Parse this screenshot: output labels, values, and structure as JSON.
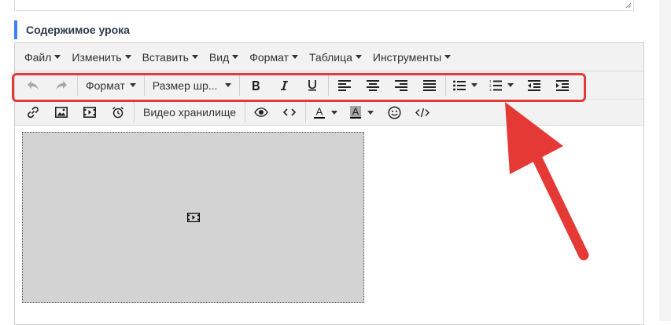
{
  "section": {
    "title": "Содержимое урока"
  },
  "menubar": {
    "items": [
      {
        "label": "Файл"
      },
      {
        "label": "Изменить"
      },
      {
        "label": "Вставить"
      },
      {
        "label": "Вид"
      },
      {
        "label": "Формат"
      },
      {
        "label": "Таблица"
      },
      {
        "label": "Инструменты"
      }
    ]
  },
  "toolbar": {
    "format_label": "Формат",
    "font_size_label": "Размер шр...",
    "video_storage_label": "Видео хранилище",
    "text_color_glyph": "A",
    "bg_color_glyph": "A"
  },
  "icons": {
    "undo": "undo-icon",
    "redo": "redo-icon",
    "bold": "bold-icon",
    "italic": "italic-icon",
    "underline": "underline-icon",
    "align_left": "align-left-icon",
    "align_center": "align-center-icon",
    "align_right": "align-right-icon",
    "justify": "align-justify-icon",
    "bullet_list": "bullet-list-icon",
    "numbered_list": "numbered-list-icon",
    "outdent": "outdent-icon",
    "indent": "indent-icon",
    "link": "link-icon",
    "image": "image-icon",
    "media": "film-icon",
    "alarm": "alarm-clock-icon",
    "preview": "eye-icon",
    "code": "code-icon",
    "emoticons": "smiley-icon",
    "source": "source-code-icon"
  },
  "colors": {
    "accent_bar": "#3b82f6",
    "highlight": "#e53935",
    "arrow": "#e53935",
    "text_color_underline": "#000000",
    "bg_color_swatch": "#a6a6a6"
  }
}
